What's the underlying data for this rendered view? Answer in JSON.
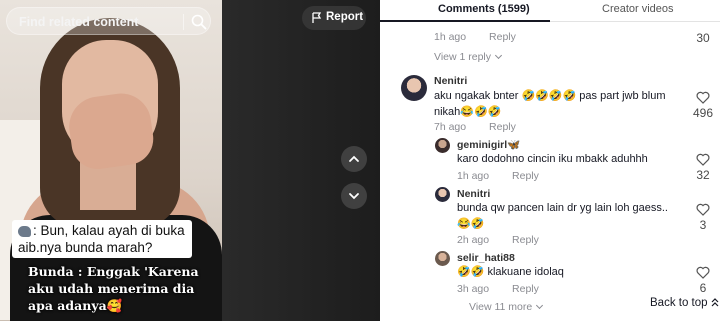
{
  "video": {
    "search_placeholder": "Find related content",
    "report_label": "Report",
    "caption_question": ": Bun, kalau ayah di buka aib.nya bunda marah?",
    "caption_answer": "Bunda : Enggak 'Karena aku udah menerima dia apa adanya🥰"
  },
  "panel": {
    "tabs": [
      {
        "label": "Comments (1599)",
        "active": true
      },
      {
        "label": "Creator videos",
        "active": false
      }
    ],
    "truncated_above": {
      "text": "...",
      "time": "1h ago",
      "reply": "Reply",
      "likes": "30"
    },
    "view_replies_1": "View 1 reply",
    "comments": [
      {
        "username": "Nenitri",
        "text": "aku ngakak bnter 🤣🤣🤣🤣 pas part jwb blum nikah😂🤣🤣",
        "time": "7h ago",
        "reply": "Reply",
        "likes": "496"
      },
      {
        "username": "geminigirl🦋",
        "text": "karo dodohno cincin iku mbakk aduhhh",
        "time": "1h ago",
        "reply": "Reply",
        "likes": "32"
      },
      {
        "username": "Nenitri",
        "text": "bunda qw pancen lain dr yg lain loh gaess..😂🤣",
        "time": "2h ago",
        "reply": "Reply",
        "likes": "3"
      },
      {
        "username": "selir_hati88",
        "text": "🤣🤣 klakuane idolaq",
        "time": "3h ago",
        "reply": "Reply",
        "likes": "6"
      }
    ],
    "view_more": "View 11 more",
    "back_to_top": "Back to top"
  },
  "colors": {
    "text": "#161823",
    "muted": "#8a8b91",
    "video_bg": "#1b1b1b"
  }
}
